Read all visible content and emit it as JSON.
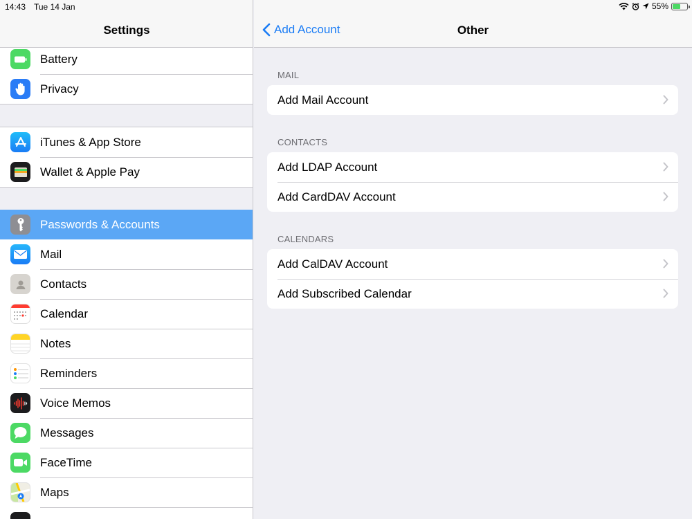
{
  "status_bar": {
    "time": "14:43",
    "date": "Tue 14 Jan",
    "battery": "55%"
  },
  "sidebar": {
    "title": "Settings",
    "groups": [
      {
        "items": [
          {
            "label": "Battery",
            "icon": "battery-icon"
          },
          {
            "label": "Privacy",
            "icon": "hand-icon"
          }
        ]
      },
      {
        "items": [
          {
            "label": "iTunes & App Store",
            "icon": "app-store-icon"
          },
          {
            "label": "Wallet & Apple Pay",
            "icon": "wallet-icon"
          }
        ]
      },
      {
        "items": [
          {
            "label": "Passwords & Accounts",
            "icon": "key-icon",
            "selected": true
          },
          {
            "label": "Mail",
            "icon": "mail-icon"
          },
          {
            "label": "Contacts",
            "icon": "contacts-icon"
          },
          {
            "label": "Calendar",
            "icon": "calendar-icon"
          },
          {
            "label": "Notes",
            "icon": "notes-icon"
          },
          {
            "label": "Reminders",
            "icon": "reminders-icon"
          },
          {
            "label": "Voice Memos",
            "icon": "voice-memos-icon"
          },
          {
            "label": "Messages",
            "icon": "messages-icon"
          },
          {
            "label": "FaceTime",
            "icon": "facetime-icon"
          },
          {
            "label": "Maps",
            "icon": "maps-icon"
          }
        ]
      }
    ]
  },
  "detail": {
    "back_label": "Add Account",
    "title": "Other",
    "sections": [
      {
        "header": "MAIL",
        "rows": [
          "Add Mail Account"
        ]
      },
      {
        "header": "CONTACTS",
        "rows": [
          "Add LDAP Account",
          "Add CardDAV Account"
        ]
      },
      {
        "header": "CALENDARS",
        "rows": [
          "Add CalDAV Account",
          "Add Subscribed Calendar"
        ]
      }
    ]
  },
  "colors": {
    "accent": "#1a7cf5",
    "selected_row": "#5ba7f5",
    "background": "#efeff4"
  }
}
